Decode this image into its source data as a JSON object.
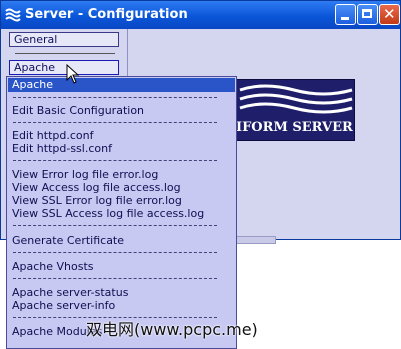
{
  "window": {
    "title": "Server - Configuration"
  },
  "nav": {
    "general": "General",
    "apache": "Apache"
  },
  "logo": {
    "text": "IFORM SERVER"
  },
  "menu": {
    "header": "Apache",
    "items": [
      "Edit Basic Configuration",
      "Edit httpd.conf",
      "Edit httpd-ssl.conf",
      "View Error log file error.log",
      "View Access log file access.log",
      "View SSL Error log file error.log",
      "View SSL Access log file access.log",
      "Generate Certificate",
      "Apache Vhosts",
      "Apache server-status",
      "Apache server-info",
      "Apache Modules"
    ]
  },
  "watermark": "双电网(www.pcpc.me)",
  "colors": {
    "titlebar": "#0a56d8",
    "menu_bg": "#c7c9f2",
    "highlight": "#2a55c8",
    "window_bg": "#d4d6f0"
  }
}
